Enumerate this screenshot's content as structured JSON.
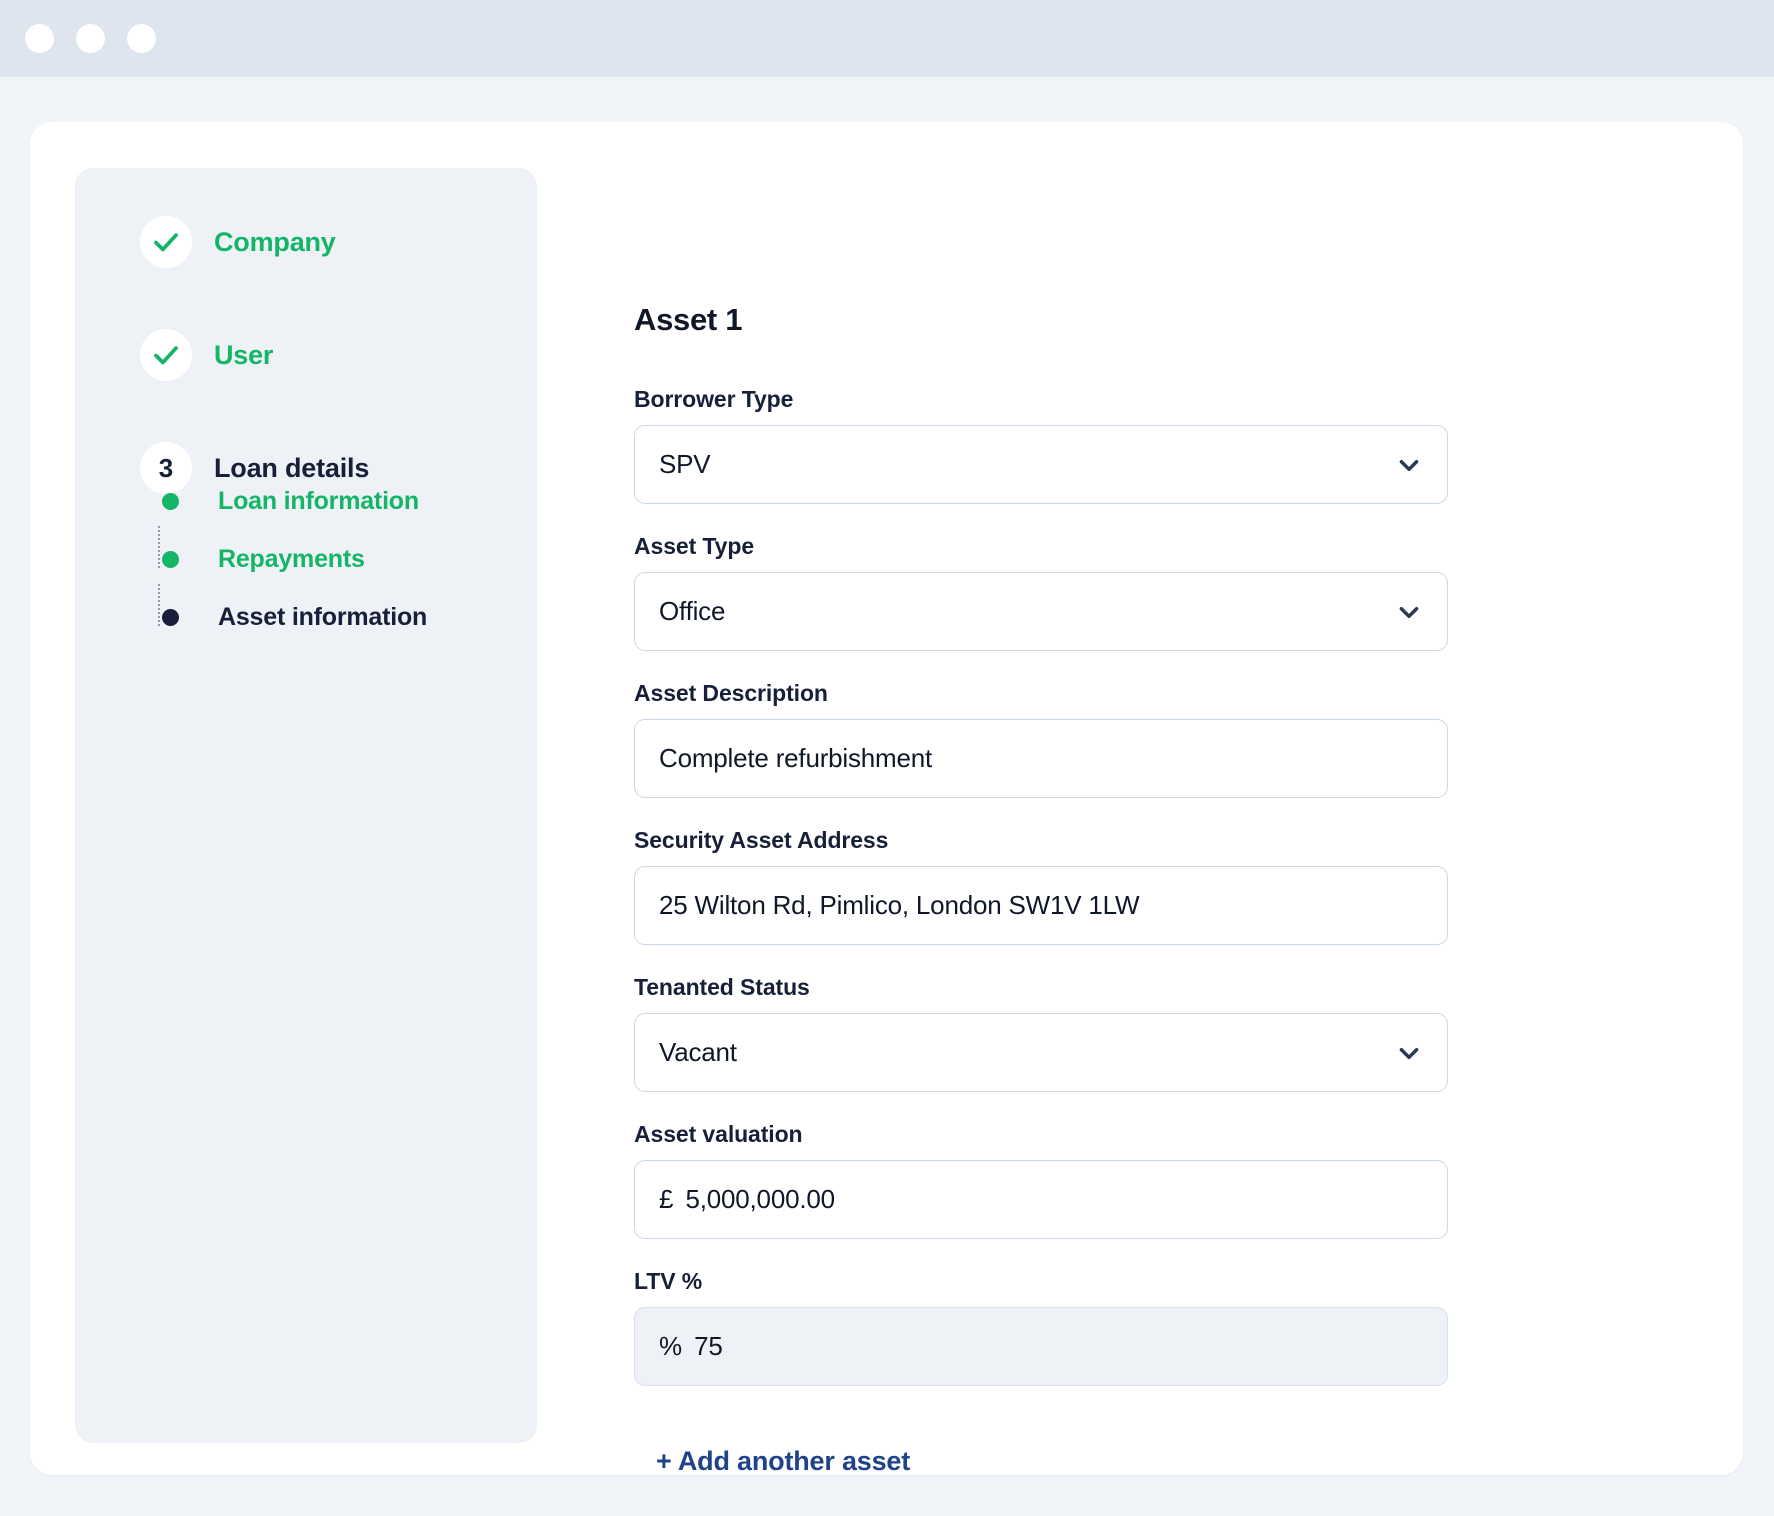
{
  "window": {
    "dots": [
      "close-dot",
      "minimize-dot",
      "maximize-dot"
    ]
  },
  "colors": {
    "green": "#15b567",
    "navy": "#172038",
    "link_blue": "#1f4289",
    "page_bg": "#f1f4f9",
    "panel_bg": "#eef2f7",
    "titlebar_bg": "#dee5ee",
    "border": "#ccd7e5"
  },
  "sidebar": {
    "steps": [
      {
        "badge": "check-icon",
        "number": "",
        "label": "Company",
        "state": "done"
      },
      {
        "badge": "check-icon",
        "number": "",
        "label": "User",
        "state": "done"
      },
      {
        "badge": "number",
        "number": "3",
        "label": "Loan details",
        "state": "current"
      }
    ],
    "substeps": [
      {
        "label": "Loan information",
        "state": "complete"
      },
      {
        "label": "Repayments",
        "state": "complete"
      },
      {
        "label": "Asset information",
        "state": "active"
      }
    ]
  },
  "form": {
    "title": "Asset 1",
    "fields": [
      {
        "label": "Borrower Type",
        "value": "SPV",
        "type": "select",
        "prefix": "",
        "readonly": false
      },
      {
        "label": "Asset Type",
        "value": "Office",
        "type": "select",
        "prefix": "",
        "readonly": false
      },
      {
        "label": "Asset Description",
        "value": "Complete refurbishment",
        "type": "text",
        "prefix": "",
        "readonly": false
      },
      {
        "label": "Security Asset Address",
        "value": "25 Wilton Rd, Pimlico, London SW1V 1LW",
        "type": "text",
        "prefix": "",
        "readonly": false
      },
      {
        "label": "Tenanted Status",
        "value": "Vacant",
        "type": "select",
        "prefix": "",
        "readonly": false
      },
      {
        "label": "Asset valuation",
        "value": "5,000,000.00",
        "type": "currency",
        "prefix": "£",
        "readonly": false
      },
      {
        "label": "LTV %",
        "value": "75",
        "type": "percent",
        "prefix": "%",
        "readonly": true
      }
    ],
    "add_asset_label": "+ Add another asset"
  }
}
